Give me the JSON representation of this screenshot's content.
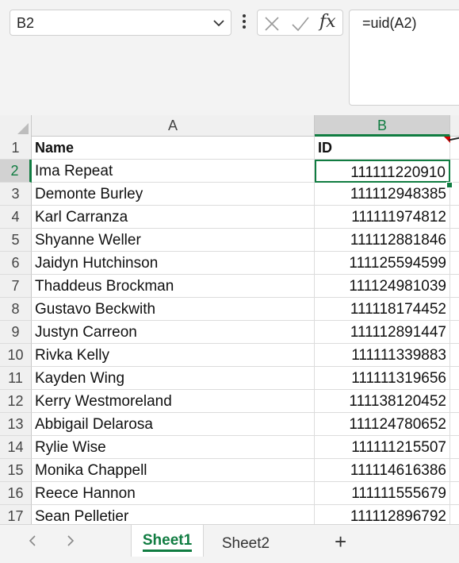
{
  "name_box": {
    "value": "B2"
  },
  "formula_bar": {
    "value": "=uid(A2)",
    "fx_label": "fx"
  },
  "columns": [
    {
      "label": "A"
    },
    {
      "label": "B"
    }
  ],
  "rows": [
    {
      "num": "1",
      "a": "Name",
      "b": "ID"
    },
    {
      "num": "2",
      "a": "Ima Repeat",
      "b": "111111220910"
    },
    {
      "num": "3",
      "a": "Demonte Burley",
      "b": "111112948385"
    },
    {
      "num": "4",
      "a": "Karl Carranza",
      "b": "111111974812"
    },
    {
      "num": "5",
      "a": "Shyanne Weller",
      "b": "111112881846"
    },
    {
      "num": "6",
      "a": "Jaidyn Hutchinson",
      "b": "111125594599"
    },
    {
      "num": "7",
      "a": "Thaddeus Brockman",
      "b": "111124981039"
    },
    {
      "num": "8",
      "a": "Gustavo Beckwith",
      "b": "111118174452"
    },
    {
      "num": "9",
      "a": "Justyn Carreon",
      "b": "111112891447"
    },
    {
      "num": "10",
      "a": "Rivka Kelly",
      "b": "111111339883"
    },
    {
      "num": "11",
      "a": "Kayden Wing",
      "b": "111111319656"
    },
    {
      "num": "12",
      "a": "Kerry Westmoreland",
      "b": "111138120452"
    },
    {
      "num": "13",
      "a": "Abbigail Delarosa",
      "b": "111124780652"
    },
    {
      "num": "14",
      "a": "Rylie Wise",
      "b": "111111215507"
    },
    {
      "num": "15",
      "a": "Monika Chappell",
      "b": "111114616386"
    },
    {
      "num": "16",
      "a": "Reece Hannon",
      "b": "111111555679"
    },
    {
      "num": "17",
      "a": "Sean Pelletier",
      "b": "111112896792"
    }
  ],
  "sheet_tabs": [
    {
      "label": "Sheet1",
      "active": true
    },
    {
      "label": "Sheet2",
      "active": false
    }
  ],
  "add_sheet_label": "+",
  "colors": {
    "accent": "#107c41",
    "comment_marker": "#d40000"
  }
}
